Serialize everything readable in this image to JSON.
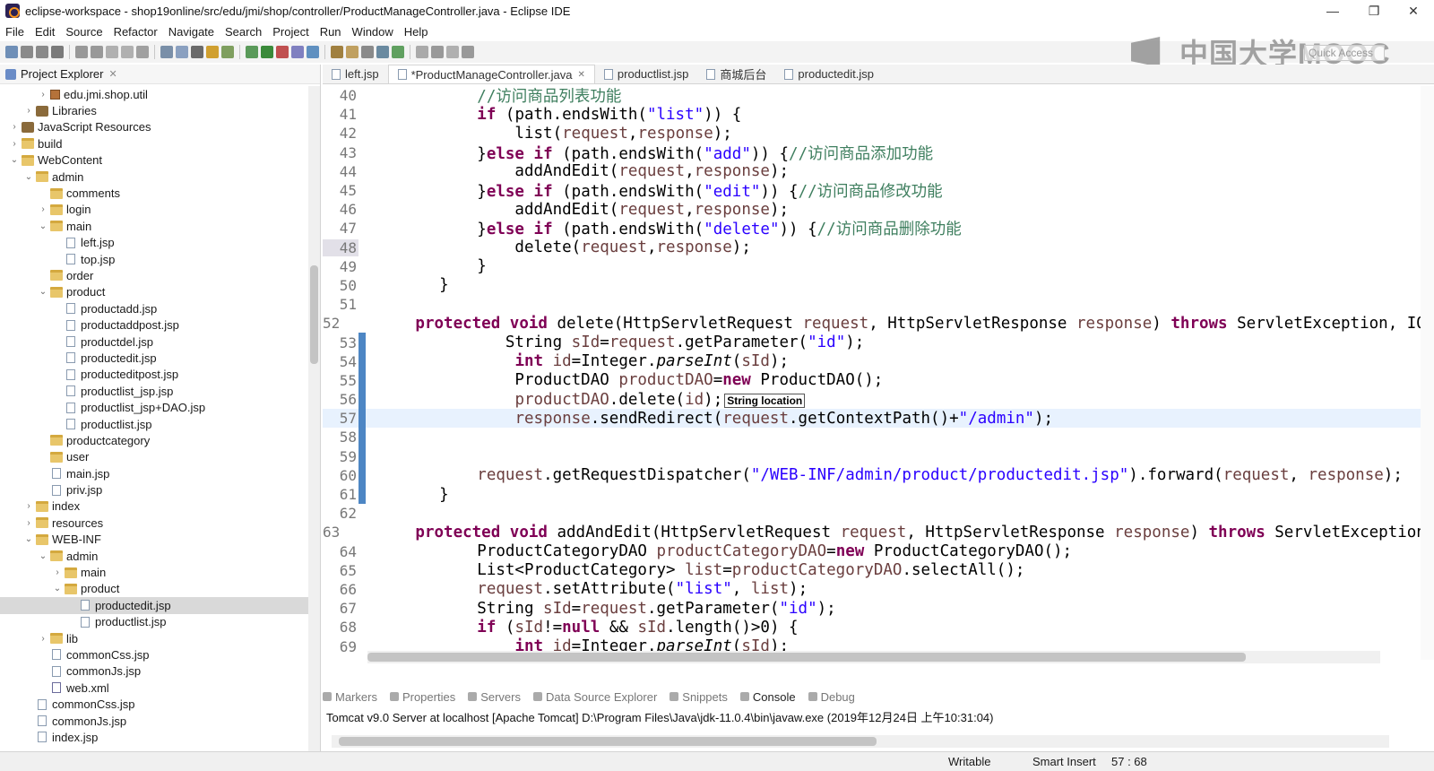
{
  "window": {
    "title": "eclipse-workspace - shop19online/src/edu/jmi/shop/controller/ProductManageController.java - Eclipse IDE"
  },
  "menu": [
    "File",
    "Edit",
    "Source",
    "Refactor",
    "Navigate",
    "Search",
    "Project",
    "Run",
    "Window",
    "Help"
  ],
  "watermark": "中国大学MOOC",
  "quick_access_placeholder": "Quick Access",
  "explorer": {
    "title": "Project Explorer",
    "items": [
      {
        "label": "edu.jmi.shop.util",
        "icon": "package-icon",
        "depth": 3,
        "arrow": "›"
      },
      {
        "label": "Libraries",
        "icon": "library-icon",
        "depth": 2,
        "arrow": "›"
      },
      {
        "label": "JavaScript Resources",
        "icon": "library-icon",
        "depth": 1,
        "arrow": "›"
      },
      {
        "label": "build",
        "icon": "folder-icon",
        "depth": 1,
        "arrow": "›"
      },
      {
        "label": "WebContent",
        "icon": "folder-icon",
        "depth": 1,
        "arrow": "⌄"
      },
      {
        "label": "admin",
        "icon": "folder-icon",
        "depth": 2,
        "arrow": "⌄"
      },
      {
        "label": "comments",
        "icon": "folder-icon",
        "depth": 3,
        "arrow": ""
      },
      {
        "label": "login",
        "icon": "folder-icon",
        "depth": 3,
        "arrow": "›"
      },
      {
        "label": "main",
        "icon": "folder-icon",
        "depth": 3,
        "arrow": "⌄"
      },
      {
        "label": "left.jsp",
        "icon": "file-icon",
        "depth": 4,
        "arrow": ""
      },
      {
        "label": "top.jsp",
        "icon": "file-icon",
        "depth": 4,
        "arrow": ""
      },
      {
        "label": "order",
        "icon": "folder-icon",
        "depth": 3,
        "arrow": ""
      },
      {
        "label": "product",
        "icon": "folder-icon",
        "depth": 3,
        "arrow": "⌄"
      },
      {
        "label": "productadd.jsp",
        "icon": "file-icon",
        "depth": 4,
        "arrow": ""
      },
      {
        "label": "productaddpost.jsp",
        "icon": "file-icon",
        "depth": 4,
        "arrow": ""
      },
      {
        "label": "productdel.jsp",
        "icon": "file-icon",
        "depth": 4,
        "arrow": ""
      },
      {
        "label": "productedit.jsp",
        "icon": "file-icon",
        "depth": 4,
        "arrow": ""
      },
      {
        "label": "producteditpost.jsp",
        "icon": "file-icon",
        "depth": 4,
        "arrow": ""
      },
      {
        "label": "productlist_jsp.jsp",
        "icon": "file-icon",
        "depth": 4,
        "arrow": ""
      },
      {
        "label": "productlist_jsp+DAO.jsp",
        "icon": "file-icon",
        "depth": 4,
        "arrow": ""
      },
      {
        "label": "productlist.jsp",
        "icon": "file-icon",
        "depth": 4,
        "arrow": ""
      },
      {
        "label": "productcategory",
        "icon": "folder-icon",
        "depth": 3,
        "arrow": ""
      },
      {
        "label": "user",
        "icon": "folder-icon",
        "depth": 3,
        "arrow": ""
      },
      {
        "label": "main.jsp",
        "icon": "file-icon",
        "depth": 3,
        "arrow": ""
      },
      {
        "label": "priv.jsp",
        "icon": "file-icon",
        "depth": 3,
        "arrow": ""
      },
      {
        "label": "index",
        "icon": "folder-icon",
        "depth": 2,
        "arrow": "›"
      },
      {
        "label": "resources",
        "icon": "folder-icon",
        "depth": 2,
        "arrow": "›"
      },
      {
        "label": "WEB-INF",
        "icon": "folder-icon",
        "depth": 2,
        "arrow": "⌄"
      },
      {
        "label": "admin",
        "icon": "folder-icon",
        "depth": 3,
        "arrow": "⌄"
      },
      {
        "label": "main",
        "icon": "folder-icon",
        "depth": 4,
        "arrow": "›"
      },
      {
        "label": "product",
        "icon": "folder-icon",
        "depth": 4,
        "arrow": "⌄"
      },
      {
        "label": "productedit.jsp",
        "icon": "file-icon",
        "depth": 5,
        "arrow": "",
        "selected": true
      },
      {
        "label": "productlist.jsp",
        "icon": "file-icon",
        "depth": 5,
        "arrow": ""
      },
      {
        "label": "lib",
        "icon": "folder-icon",
        "depth": 3,
        "arrow": "›"
      },
      {
        "label": "commonCss.jsp",
        "icon": "file-icon",
        "depth": 3,
        "arrow": ""
      },
      {
        "label": "commonJs.jsp",
        "icon": "file-icon",
        "depth": 3,
        "arrow": ""
      },
      {
        "label": "web.xml",
        "icon": "xml-icon",
        "depth": 3,
        "arrow": ""
      },
      {
        "label": "commonCss.jsp",
        "icon": "file-icon",
        "depth": 2,
        "arrow": ""
      },
      {
        "label": "commonJs.jsp",
        "icon": "file-icon",
        "depth": 2,
        "arrow": ""
      },
      {
        "label": "index.jsp",
        "icon": "file-icon",
        "depth": 2,
        "arrow": ""
      }
    ]
  },
  "editor": {
    "tabs": [
      {
        "label": "left.jsp",
        "active": false
      },
      {
        "label": "*ProductManageController.java",
        "active": true
      },
      {
        "label": "productlist.jsp",
        "active": false
      },
      {
        "label": "商城后台",
        "active": false
      },
      {
        "label": "productedit.jsp",
        "active": false
      }
    ],
    "tooltip": "String location",
    "lines": [
      {
        "n": "40",
        "tokens": [
          [
            "        ",
            ""
          ],
          [
            "//访问商品列表功能",
            "cm"
          ]
        ]
      },
      {
        "n": "41",
        "tokens": [
          [
            "        ",
            ""
          ],
          [
            "if",
            "kw"
          ],
          [
            " (path.endsWith(",
            ""
          ],
          [
            "\"list\"",
            "str"
          ],
          [
            ")) {",
            ""
          ]
        ]
      },
      {
        "n": "42",
        "tokens": [
          [
            "            list(",
            ""
          ],
          [
            "request",
            "fld"
          ],
          [
            ",",
            ""
          ],
          [
            "response",
            "fld"
          ],
          [
            ");",
            ""
          ]
        ]
      },
      {
        "n": "43",
        "tokens": [
          [
            "        }",
            ""
          ],
          [
            "else",
            "kw"
          ],
          [
            " ",
            ""
          ],
          [
            "if",
            "kw"
          ],
          [
            " (path.endsWith(",
            ""
          ],
          [
            "\"add\"",
            "str"
          ],
          [
            ")) {",
            ""
          ],
          [
            "//访问商品添加功能",
            "cm"
          ]
        ]
      },
      {
        "n": "44",
        "tokens": [
          [
            "            addAndEdit(",
            ""
          ],
          [
            "request",
            "fld"
          ],
          [
            ",",
            ""
          ],
          [
            "response",
            "fld"
          ],
          [
            ");",
            ""
          ]
        ]
      },
      {
        "n": "45",
        "tokens": [
          [
            "        }",
            ""
          ],
          [
            "else",
            "kw"
          ],
          [
            " ",
            ""
          ],
          [
            "if",
            "kw"
          ],
          [
            " (path.endsWith(",
            ""
          ],
          [
            "\"edit\"",
            "str"
          ],
          [
            ")) {",
            ""
          ],
          [
            "//访问商品修改功能",
            "cm"
          ]
        ]
      },
      {
        "n": "46",
        "tokens": [
          [
            "            addAndEdit(",
            ""
          ],
          [
            "request",
            "fld"
          ],
          [
            ",",
            ""
          ],
          [
            "response",
            "fld"
          ],
          [
            ");",
            ""
          ]
        ]
      },
      {
        "n": "47",
        "tokens": [
          [
            "        }",
            ""
          ],
          [
            "else",
            "kw"
          ],
          [
            " ",
            ""
          ],
          [
            "if",
            "kw"
          ],
          [
            " (path.endsWith(",
            ""
          ],
          [
            "\"delete\"",
            "str"
          ],
          [
            ")) {",
            ""
          ],
          [
            "//访问商品删除功能",
            "cm"
          ]
        ]
      },
      {
        "n": "48",
        "tokens": [
          [
            "            delete(",
            ""
          ],
          [
            "request",
            "fld"
          ],
          [
            ",",
            ""
          ],
          [
            "response",
            "fld"
          ],
          [
            ");",
            ""
          ]
        ]
      },
      {
        "n": "49",
        "tokens": [
          [
            "        }",
            ""
          ]
        ]
      },
      {
        "n": "50",
        "tokens": [
          [
            "    }",
            ""
          ]
        ]
      },
      {
        "n": "51",
        "tokens": [
          [
            "",
            ""
          ]
        ]
      },
      {
        "n": "52",
        "tokens": [
          [
            "    ",
            ""
          ],
          [
            "protected",
            "kw"
          ],
          [
            " ",
            ""
          ],
          [
            "void",
            "kw"
          ],
          [
            " delete(HttpServletRequest ",
            ""
          ],
          [
            "request",
            "fld"
          ],
          [
            ", HttpServletResponse ",
            ""
          ],
          [
            "response",
            "fld"
          ],
          [
            ") ",
            ""
          ],
          [
            "throws",
            "kw"
          ],
          [
            " ServletException, IO",
            ""
          ]
        ]
      },
      {
        "n": "53",
        "tokens": [
          [
            "           String ",
            ""
          ],
          [
            "sId",
            "fld"
          ],
          [
            "=",
            ""
          ],
          [
            "request",
            "fld"
          ],
          [
            ".getParameter(",
            ""
          ],
          [
            "\"id\"",
            "str"
          ],
          [
            ");",
            ""
          ]
        ]
      },
      {
        "n": "54",
        "tokens": [
          [
            "            ",
            ""
          ],
          [
            "int",
            "kw"
          ],
          [
            " ",
            ""
          ],
          [
            "id",
            "fld"
          ],
          [
            "=Integer.",
            ""
          ],
          [
            "parseInt",
            "itl"
          ],
          [
            "(",
            ""
          ],
          [
            "sId",
            "fld"
          ],
          [
            ");",
            ""
          ]
        ]
      },
      {
        "n": "55",
        "tokens": [
          [
            "            ProductDAO ",
            ""
          ],
          [
            "productDAO",
            "fld"
          ],
          [
            "=",
            ""
          ],
          [
            "new",
            "kw"
          ],
          [
            " ProductDAO();",
            ""
          ]
        ]
      },
      {
        "n": "56",
        "tokens": [
          [
            "            ",
            ""
          ],
          [
            "productDAO",
            "fld"
          ],
          [
            ".delete(",
            ""
          ],
          [
            "id",
            "fld"
          ],
          [
            ");",
            ""
          ]
        ]
      },
      {
        "n": "57",
        "tokens": [
          [
            "            ",
            ""
          ],
          [
            "response",
            "fld"
          ],
          [
            ".sendRedirect(",
            ""
          ],
          [
            "request",
            "fld"
          ],
          [
            ".getContextPath()+",
            ""
          ],
          [
            "\"/admin\"",
            "str"
          ],
          [
            ");",
            ""
          ]
        ]
      },
      {
        "n": "58",
        "tokens": [
          [
            "",
            ""
          ]
        ]
      },
      {
        "n": "59",
        "tokens": [
          [
            "",
            ""
          ]
        ]
      },
      {
        "n": "60",
        "tokens": [
          [
            "        ",
            ""
          ],
          [
            "request",
            "fld"
          ],
          [
            ".getRequestDispatcher(",
            ""
          ],
          [
            "\"/WEB-INF/admin/product/productedit.jsp\"",
            "str"
          ],
          [
            ").forward(",
            ""
          ],
          [
            "request",
            "fld"
          ],
          [
            ", ",
            ""
          ],
          [
            "response",
            "fld"
          ],
          [
            ");",
            ""
          ]
        ]
      },
      {
        "n": "61",
        "tokens": [
          [
            "    }",
            ""
          ]
        ]
      },
      {
        "n": "62",
        "tokens": [
          [
            "",
            ""
          ]
        ]
      },
      {
        "n": "63",
        "tokens": [
          [
            "    ",
            ""
          ],
          [
            "protected",
            "kw"
          ],
          [
            " ",
            ""
          ],
          [
            "void",
            "kw"
          ],
          [
            " addAndEdit(HttpServletRequest ",
            ""
          ],
          [
            "request",
            "fld"
          ],
          [
            ", HttpServletResponse ",
            ""
          ],
          [
            "response",
            "fld"
          ],
          [
            ") ",
            ""
          ],
          [
            "throws",
            "kw"
          ],
          [
            " ServletException",
            ""
          ]
        ]
      },
      {
        "n": "64",
        "tokens": [
          [
            "        ProductCategoryDAO ",
            ""
          ],
          [
            "productCategoryDAO",
            "fld"
          ],
          [
            "=",
            ""
          ],
          [
            "new",
            "kw"
          ],
          [
            " ProductCategoryDAO();",
            ""
          ]
        ]
      },
      {
        "n": "65",
        "tokens": [
          [
            "        List<ProductCategory> ",
            ""
          ],
          [
            "list",
            "fld"
          ],
          [
            "=",
            ""
          ],
          [
            "productCategoryDAO",
            "fld"
          ],
          [
            ".selectAll();",
            ""
          ]
        ]
      },
      {
        "n": "66",
        "tokens": [
          [
            "        ",
            ""
          ],
          [
            "request",
            "fld"
          ],
          [
            ".setAttribute(",
            ""
          ],
          [
            "\"list\"",
            "str"
          ],
          [
            ", ",
            ""
          ],
          [
            "list",
            "fld"
          ],
          [
            ");",
            ""
          ]
        ]
      },
      {
        "n": "67",
        "tokens": [
          [
            "        String ",
            ""
          ],
          [
            "sId",
            "fld"
          ],
          [
            "=",
            ""
          ],
          [
            "request",
            "fld"
          ],
          [
            ".getParameter(",
            ""
          ],
          [
            "\"id\"",
            "str"
          ],
          [
            ");",
            ""
          ]
        ]
      },
      {
        "n": "68",
        "tokens": [
          [
            "        ",
            ""
          ],
          [
            "if",
            "kw"
          ],
          [
            " (",
            ""
          ],
          [
            "sId",
            "fld"
          ],
          [
            "!=",
            ""
          ],
          [
            "null",
            "kw"
          ],
          [
            " && ",
            ""
          ],
          [
            "sId",
            "fld"
          ],
          [
            ".length()>0) {",
            ""
          ]
        ]
      },
      {
        "n": "69",
        "tokens": [
          [
            "            ",
            ""
          ],
          [
            "int",
            "kw"
          ],
          [
            " ",
            ""
          ],
          [
            "id",
            "fld"
          ],
          [
            "=Integer.",
            ""
          ],
          [
            "parseInt",
            "itl"
          ],
          [
            "(",
            ""
          ],
          [
            "sId",
            "fld"
          ],
          [
            ");",
            ""
          ]
        ]
      }
    ]
  },
  "console": {
    "tabs": [
      "Markers",
      "Properties",
      "Servers",
      "Data Source Explorer",
      "Snippets",
      "Console",
      "Debug"
    ],
    "active_tab": "Console",
    "line": "Tomcat v9.0 Server at localhost [Apache Tomcat] D:\\Program Files\\Java\\jdk-11.0.4\\bin\\javaw.exe (2019年12月24日 上午10:31:04)"
  },
  "status": {
    "writable": "Writable",
    "insert_mode": "Smart Insert",
    "position": "57 : 68"
  }
}
